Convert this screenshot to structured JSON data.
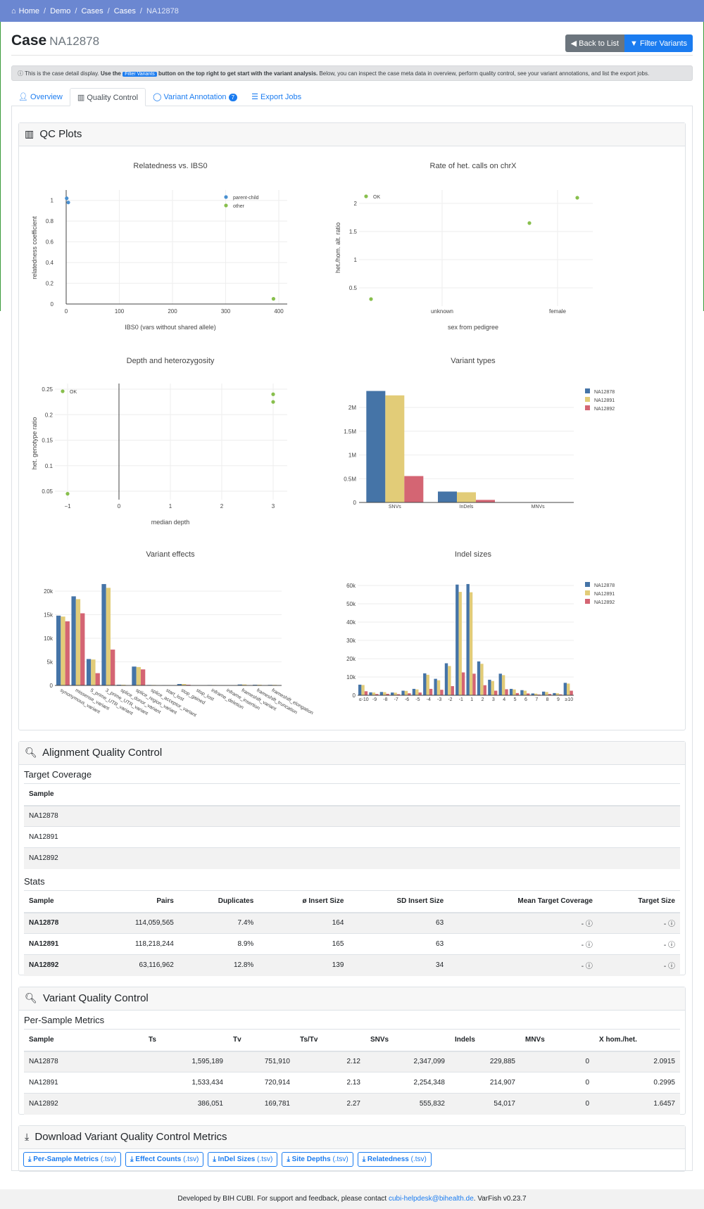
{
  "breadcrumb": [
    "Home",
    "Demo",
    "Cases",
    "Cases",
    "NA12878"
  ],
  "page": {
    "title": "Case",
    "case_name": "NA12878"
  },
  "buttons": {
    "back": "Back to List",
    "filter": "Filter Variants"
  },
  "alert": {
    "pre": "This is the case detail display. ",
    "use": "Use the ",
    "chip": "Filter Variants",
    "bold_rest": " button on the top right to get start with the variant analysis.",
    "rest": " Below, you can inspect the case meta data in overview, perform quality control, see your variant annotations, and list the export jobs."
  },
  "tabs": {
    "overview": "Overview",
    "qc": "Quality Control",
    "annotation": "Variant Annotation",
    "annotation_count": "7",
    "export": "Export Jobs"
  },
  "qc_card": {
    "title": "QC Plots"
  },
  "colors": {
    "blue": "#4574a7",
    "yellow": "#e2cc78",
    "red": "#d46573",
    "green": "#88bf4d",
    "dot_blue": "#4a90d0"
  },
  "chart_data": [
    {
      "type": "scatter",
      "title": "Relatedness vs. IBS0",
      "xlabel": "IBS0 (vars without shared allele)",
      "ylabel": "relatedness coefficient",
      "xlim": [
        -5,
        415
      ],
      "ylim": [
        0,
        1.1
      ],
      "xticks": [
        "0",
        "100",
        "200",
        "300",
        "400"
      ],
      "yticks": [
        "0",
        "0.2",
        "0.4",
        "0.6",
        "0.8",
        "1"
      ],
      "series": [
        {
          "name": "parent-child",
          "points": [
            [
              1,
              1.02
            ],
            [
              4,
              0.98
            ]
          ]
        },
        {
          "name": "other",
          "points": [
            [
              390,
              0.05
            ]
          ]
        }
      ]
    },
    {
      "type": "scatter",
      "title": "Rate of het. calls on chrX",
      "xlabel": "sex from pedigree",
      "ylabel": "het./hom. alt. ratio",
      "categories": [
        "unknown",
        "female"
      ],
      "yticks": [
        "0.5",
        "1",
        "1.5",
        "2"
      ],
      "series": [
        {
          "name": "OK",
          "points": [
            [
              "unknown",
              0.3
            ],
            [
              "female",
              1.65
            ],
            [
              "female",
              2.1
            ]
          ]
        }
      ]
    },
    {
      "type": "scatter",
      "title": "Depth and heterozygosity",
      "xlabel": "median depth",
      "ylabel": "het. genotype ratio",
      "xlim": [
        -1.2,
        3.3
      ],
      "ylim": [
        0.03,
        0.26
      ],
      "xticks": [
        "−1",
        "0",
        "1",
        "2",
        "3"
      ],
      "yticks": [
        "0.05",
        "0.1",
        "0.15",
        "0.2",
        "0.25"
      ],
      "series": [
        {
          "name": "OK",
          "points": [
            [
              -1,
              0.045
            ],
            [
              3,
              0.24
            ],
            [
              3,
              0.225
            ]
          ]
        }
      ]
    },
    {
      "type": "bar",
      "title": "Variant types",
      "categories": [
        "SNVs",
        "InDels",
        "MNVs"
      ],
      "yticks": [
        "0",
        "0.5M",
        "1M",
        "1.5M",
        "2M"
      ],
      "ylim": [
        0,
        2500000
      ],
      "series": [
        {
          "name": "NA12878",
          "values": [
            2347099,
            229885,
            0
          ]
        },
        {
          "name": "NA12891",
          "values": [
            2254348,
            214907,
            0
          ]
        },
        {
          "name": "NA12892",
          "values": [
            555832,
            54017,
            0
          ]
        }
      ]
    },
    {
      "type": "bar",
      "title": "Variant effects",
      "categories": [
        "synonymous_variant",
        "missense_variant",
        "5_prime_UTR_variant",
        "3_prime_UTR_variant",
        "splice_donor_variant",
        "splice_region_variant",
        "splice_acceptor_variant",
        "start_lost",
        "stop_gained",
        "stop_lost",
        "inframe_deletion",
        "inframe_insertion",
        "frameshift_variant",
        "frameshift_truncation",
        "frameshift_elongation"
      ],
      "yticks": [
        "0",
        "5k",
        "10k",
        "15k",
        "20k"
      ],
      "ylim": [
        0,
        22000
      ],
      "series": [
        {
          "name": "NA12878",
          "values": [
            14800,
            18900,
            5600,
            21500,
            150,
            4000,
            100,
            80,
            300,
            60,
            90,
            60,
            200,
            150,
            120
          ]
        },
        {
          "name": "NA12891",
          "values": [
            14600,
            18300,
            5500,
            20700,
            150,
            3900,
            100,
            80,
            300,
            60,
            90,
            60,
            200,
            150,
            120
          ]
        },
        {
          "name": "NA12892",
          "values": [
            13600,
            15300,
            2600,
            7600,
            50,
            3400,
            40,
            30,
            150,
            20,
            30,
            20,
            80,
            60,
            50
          ]
        }
      ]
    },
    {
      "type": "bar",
      "title": "Indel sizes",
      "categories": [
        "≤-10",
        "-9",
        "-8",
        "-7",
        "-6",
        "-5",
        "-4",
        "-3",
        "-2",
        "-1",
        "1",
        "2",
        "3",
        "4",
        "5",
        "6",
        "7",
        "8",
        "9",
        "≥10"
      ],
      "yticks": [
        "0",
        "10k",
        "20k",
        "30k",
        "40k",
        "50k",
        "60k"
      ],
      "ylim": [
        0,
        63000
      ],
      "series": [
        {
          "name": "NA12878",
          "values": [
            5800,
            1600,
            1800,
            1500,
            2500,
            3500,
            12000,
            9000,
            17500,
            60500,
            60800,
            18500,
            8500,
            11800,
            3500,
            2800,
            1000,
            2000,
            1200,
            6800
          ]
        },
        {
          "name": "NA12891",
          "values": [
            5600,
            1500,
            1700,
            1400,
            2400,
            3200,
            11200,
            8200,
            16000,
            56500,
            56300,
            17200,
            7800,
            11000,
            3200,
            2500,
            900,
            1800,
            1100,
            6400
          ]
        },
        {
          "name": "NA12892",
          "values": [
            2200,
            700,
            800,
            600,
            1100,
            1500,
            3500,
            3000,
            5000,
            12500,
            11800,
            5500,
            2500,
            3300,
            1200,
            1000,
            400,
            700,
            500,
            2500
          ]
        }
      ]
    }
  ],
  "alignment": {
    "title": "Alignment Quality Control",
    "target_coverage": {
      "title": "Target Coverage",
      "header": "Sample",
      "rows": [
        "NA12878",
        "NA12891",
        "NA12892"
      ]
    },
    "stats": {
      "title": "Stats",
      "headers": [
        "Sample",
        "Pairs",
        "Duplicates",
        "ø Insert Size",
        "SD Insert Size",
        "Mean Target Coverage",
        "Target Size"
      ],
      "rows": [
        [
          "NA12878",
          "114,059,565",
          "7.4%",
          "164",
          "63",
          "-",
          "-"
        ],
        [
          "NA12891",
          "118,218,244",
          "8.9%",
          "165",
          "63",
          "-",
          "-"
        ],
        [
          "NA12892",
          "63,116,962",
          "12.8%",
          "139",
          "34",
          "-",
          "-"
        ]
      ]
    }
  },
  "variant_qc": {
    "title": "Variant Quality Control",
    "per_sample": {
      "title": "Per-Sample Metrics",
      "headers": [
        "Sample",
        "Ts",
        "Tv",
        "Ts/Tv",
        "SNVs",
        "Indels",
        "MNVs",
        "X hom./het."
      ],
      "rows": [
        [
          "NA12878",
          "1,595,189",
          "751,910",
          "2.12",
          "2,347,099",
          "229,885",
          "0",
          "2.0915"
        ],
        [
          "NA12891",
          "1,533,434",
          "720,914",
          "2.13",
          "2,254,348",
          "214,907",
          "0",
          "0.2995"
        ],
        [
          "NA12892",
          "386,051",
          "169,781",
          "2.27",
          "555,832",
          "54,017",
          "0",
          "1.6457"
        ]
      ]
    }
  },
  "download": {
    "title": "Download Variant Quality Control Metrics",
    "buttons": [
      {
        "label": "Per-Sample Metrics",
        "ext": "(.tsv)"
      },
      {
        "label": "Effect Counts",
        "ext": "(.tsv)"
      },
      {
        "label": "InDel Sizes",
        "ext": "(.tsv)"
      },
      {
        "label": "Site Depths",
        "ext": "(.tsv)"
      },
      {
        "label": "Relatedness",
        "ext": "(.tsv)"
      }
    ]
  },
  "footer": {
    "pre": "Developed by BIH CUBI. For support and feedback, please contact ",
    "email": "cubi-helpdesk@bihealth.de",
    "post": ". VarFish v0.23.7"
  }
}
